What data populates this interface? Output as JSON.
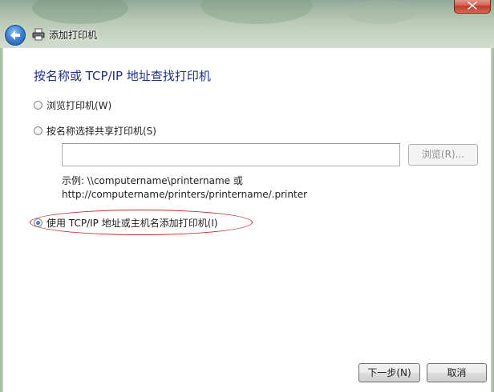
{
  "window": {
    "title": "添加打印机",
    "icons": [
      "back-arrow-icon",
      "printer-icon",
      "close-icon"
    ]
  },
  "main": {
    "heading": "按名称或 TCP/IP 地址查找打印机",
    "options": [
      {
        "label": "浏览打印机(W)",
        "selected": false
      },
      {
        "label": "按名称选择共享打印机(S)",
        "selected": false
      },
      {
        "label": "使用 TCP/IP 地址或主机名添加打印机(I)",
        "selected": true
      }
    ],
    "share_input": {
      "value": ""
    },
    "browse_button": "浏览(R)...",
    "example_line1": "示例: \\\\computername\\printername 或",
    "example_line2": "http://computername/printers/printername/.printer"
  },
  "footer": {
    "next_button": "下一步(N)",
    "cancel_button": "取消"
  },
  "colors": {
    "heading": "#1e3287",
    "highlight": "#c42a2a"
  }
}
